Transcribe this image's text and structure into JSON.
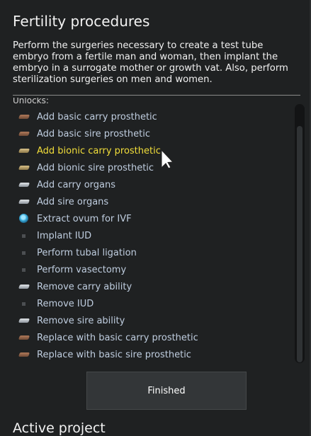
{
  "panel": {
    "title": "Fertility procedures",
    "description": "Perform the surgeries necessary to create a test tube embryo from a fertile man and woman, then implant the embryo in a surrogate mother or growth vat. Also, perform sterilization surgeries on men and women.",
    "unlocks_label": "Unlocks:"
  },
  "unlocks": [
    {
      "label": "Add basic carry prosthetic",
      "icon": "brown-block-icon",
      "highlighted": false
    },
    {
      "label": "Add basic sire prosthetic",
      "icon": "brown-block-icon",
      "highlighted": false
    },
    {
      "label": "Add bionic carry prosthetic",
      "icon": "gold-block-icon",
      "highlighted": true
    },
    {
      "label": "Add bionic sire prosthetic",
      "icon": "gold-block-icon",
      "highlighted": false
    },
    {
      "label": "Add carry organs",
      "icon": "silver-block-icon",
      "highlighted": false
    },
    {
      "label": "Add sire organs",
      "icon": "silver-block-icon",
      "highlighted": false
    },
    {
      "label": "Extract ovum for IVF",
      "icon": "ovum-icon",
      "highlighted": false
    },
    {
      "label": "Implant IUD",
      "icon": "dot-icon",
      "highlighted": false
    },
    {
      "label": "Perform tubal ligation",
      "icon": "dot-icon",
      "highlighted": false
    },
    {
      "label": "Perform vasectomy",
      "icon": "dot-icon",
      "highlighted": false
    },
    {
      "label": "Remove carry ability",
      "icon": "silver-block-icon",
      "highlighted": false
    },
    {
      "label": "Remove IUD",
      "icon": "dot-icon",
      "highlighted": false
    },
    {
      "label": "Remove sire ability",
      "icon": "silver-block-icon",
      "highlighted": false
    },
    {
      "label": "Replace with basic carry prosthetic",
      "icon": "brown-block-icon",
      "highlighted": false
    },
    {
      "label": "Replace with basic sire prosthetic",
      "icon": "brown-block-icon",
      "highlighted": false
    }
  ],
  "finish_button": {
    "label": "Finished"
  },
  "next_section": {
    "title": "Active project"
  },
  "colors": {
    "highlight": "#f2de3a",
    "item_text": "#bfcddf",
    "background": "#1f2122"
  }
}
